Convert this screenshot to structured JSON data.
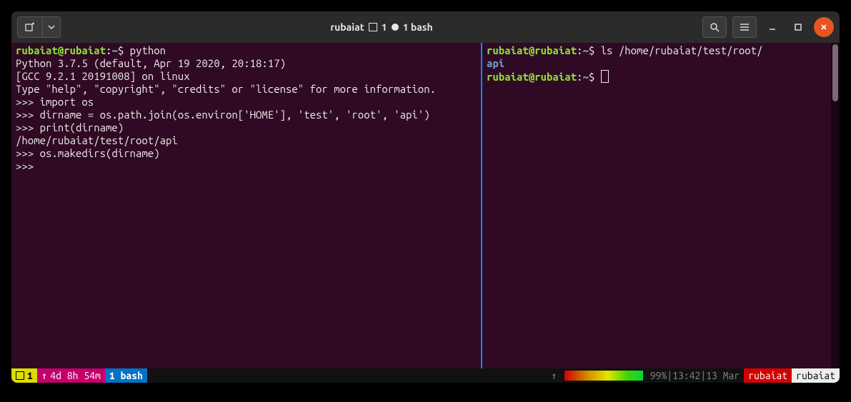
{
  "titlebar": {
    "title_prefix": "rubaiat",
    "title_num1": "1",
    "title_num2": "1 bash"
  },
  "left_pane": {
    "prompt": {
      "user": "rubaiat",
      "at": "@",
      "host": "rubaiat",
      "colon": ":",
      "path": "~",
      "dollar": "$ "
    },
    "cmd1": "python",
    "line2": "Python 3.7.5 (default, Apr 19 2020, 20:18:17)",
    "line3": "[GCC 9.2.1 20191008] on linux",
    "line4": "Type \"help\", \"copyright\", \"credits\" or \"license\" for more information.",
    "line5": ">>> import os",
    "line6": ">>> dirname = os.path.join(os.environ['HOME'], 'test', 'root', 'api')",
    "line7": ">>> print(dirname)",
    "line8": "/home/rubaiat/test/root/api",
    "line9": ">>> os.makedirs(dirname)",
    "line10": ">>> "
  },
  "right_pane": {
    "prompt": {
      "user": "rubaiat",
      "at": "@",
      "host": "rubaiat",
      "colon": ":",
      "path": "~",
      "dollar": "$ "
    },
    "cmd1": "ls /home/rubaiat/test/root/",
    "out1": "api"
  },
  "status": {
    "seg_session": "1",
    "uptime_arrow": "↑",
    "uptime": "4d 8h 54m",
    "window": "1 bash",
    "arrow_up": "↑",
    "battery": "99%",
    "sep": " | ",
    "time": "13:42",
    "date": "13 Mar",
    "host1": "rubaiat",
    "host2": "rubaiat"
  },
  "colors": {
    "terminal_bg": "#300a24",
    "user_green": "#8ae234",
    "path_blue": "#729fcf",
    "accent_orange": "#e95420"
  }
}
